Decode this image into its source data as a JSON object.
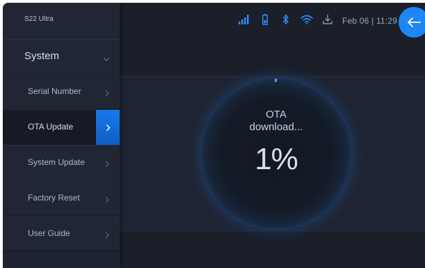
{
  "device": {
    "name": "S22 Ultra"
  },
  "status": {
    "date_time": "Feb 06 | 11:29",
    "icons": [
      "signal-icon",
      "battery-icon",
      "bluetooth-icon",
      "wifi-icon",
      "download-icon"
    ],
    "accent_color": "#1f86f5"
  },
  "sidebar": {
    "section_title": "System",
    "items": [
      {
        "label": "Serial Number",
        "active": false
      },
      {
        "label": "OTA Update",
        "active": true
      },
      {
        "label": "System Update",
        "active": false
      },
      {
        "label": "Factory Reset",
        "active": false
      },
      {
        "label": "User Guide",
        "active": false
      }
    ]
  },
  "ota": {
    "status_line1": "OTA",
    "status_line2": "download...",
    "progress_text": "1%",
    "progress_fraction": 0.01
  }
}
